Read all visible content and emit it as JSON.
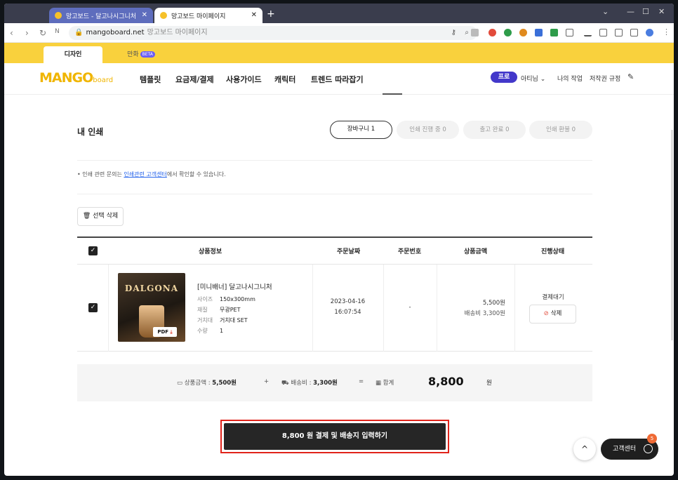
{
  "browser": {
    "tabs": [
      {
        "label": "망고보드 - 달고나시그니처"
      },
      {
        "label": "망고보드 마이페이지"
      }
    ],
    "new_tab": "+",
    "url_domain": "mangoboard.net",
    "url_title": "망고보드 마이페이지"
  },
  "site": {
    "top_tabs": [
      {
        "label": "디자인"
      },
      {
        "label": "만화",
        "badge": "BETA"
      }
    ],
    "logo_main": "MANGO",
    "logo_sub": "board",
    "nav": [
      "템플릿",
      "요금제/결제",
      "사용가이드",
      "캐릭터",
      "트렌드 따라잡기"
    ],
    "pro_badge": "프로",
    "user": "아티님",
    "my_work": "나의 작업",
    "copyright": "저작권 규정"
  },
  "print": {
    "title": "내 인쇄",
    "status_tabs": [
      {
        "label": "장바구니 1",
        "active": true
      },
      {
        "label": "인쇄 진행 중 0",
        "active": false
      },
      {
        "label": "출고 완료 0",
        "active": false
      },
      {
        "label": "인쇄 환불 0",
        "active": false
      }
    ],
    "notice_pre": "• 인쇄 관련 문의는 ",
    "notice_link": "인쇄관련 고객센터",
    "notice_post": "에서 확인할 수 있습니다.",
    "delete_selected": "선택 삭제",
    "columns": [
      "상품정보",
      "주문날짜",
      "주문번호",
      "상품금액",
      "진행상태"
    ],
    "item": {
      "thumb_title": "DALGONA",
      "thumb_pdf": "PDF",
      "name": "[미니배너] 달고나시그니처",
      "specs": [
        {
          "k": "사이즈",
          "v": "150x300mm"
        },
        {
          "k": "재질",
          "v": "무광PET"
        },
        {
          "k": "거치대",
          "v": "거치대 SET"
        },
        {
          "k": "수량",
          "v": "1"
        }
      ],
      "date": "2023-04-16",
      "time": "16:07:54",
      "order_no": "-",
      "price": "5,500원",
      "shipping": "배송비 3,300원",
      "status": "결제대기",
      "delete": "삭제"
    },
    "summary": {
      "product_label": "상품금액 : ",
      "product_value": "5,500원",
      "plus": "+",
      "shipping_label": "배송비 : ",
      "shipping_value": "3,300원",
      "equals": "=",
      "total_label": "합계",
      "total_value": "8,800",
      "total_unit": "원"
    },
    "pay_button": "8,800 원 결제 및 배송지 입력하기"
  },
  "floating": {
    "scroll_top": "^",
    "customer_center": "고객센터",
    "badge": "5"
  }
}
